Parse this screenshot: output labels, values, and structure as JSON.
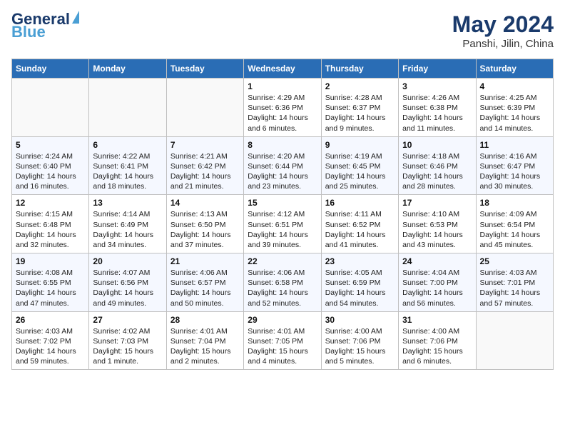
{
  "header": {
    "logo_line1": "General",
    "logo_line2": "Blue",
    "month": "May 2024",
    "location": "Panshi, Jilin, China"
  },
  "weekdays": [
    "Sunday",
    "Monday",
    "Tuesday",
    "Wednesday",
    "Thursday",
    "Friday",
    "Saturday"
  ],
  "weeks": [
    [
      {
        "day": "",
        "detail": ""
      },
      {
        "day": "",
        "detail": ""
      },
      {
        "day": "",
        "detail": ""
      },
      {
        "day": "1",
        "detail": "Sunrise: 4:29 AM\nSunset: 6:36 PM\nDaylight: 14 hours\nand 6 minutes."
      },
      {
        "day": "2",
        "detail": "Sunrise: 4:28 AM\nSunset: 6:37 PM\nDaylight: 14 hours\nand 9 minutes."
      },
      {
        "day": "3",
        "detail": "Sunrise: 4:26 AM\nSunset: 6:38 PM\nDaylight: 14 hours\nand 11 minutes."
      },
      {
        "day": "4",
        "detail": "Sunrise: 4:25 AM\nSunset: 6:39 PM\nDaylight: 14 hours\nand 14 minutes."
      }
    ],
    [
      {
        "day": "5",
        "detail": "Sunrise: 4:24 AM\nSunset: 6:40 PM\nDaylight: 14 hours\nand 16 minutes."
      },
      {
        "day": "6",
        "detail": "Sunrise: 4:22 AM\nSunset: 6:41 PM\nDaylight: 14 hours\nand 18 minutes."
      },
      {
        "day": "7",
        "detail": "Sunrise: 4:21 AM\nSunset: 6:42 PM\nDaylight: 14 hours\nand 21 minutes."
      },
      {
        "day": "8",
        "detail": "Sunrise: 4:20 AM\nSunset: 6:44 PM\nDaylight: 14 hours\nand 23 minutes."
      },
      {
        "day": "9",
        "detail": "Sunrise: 4:19 AM\nSunset: 6:45 PM\nDaylight: 14 hours\nand 25 minutes."
      },
      {
        "day": "10",
        "detail": "Sunrise: 4:18 AM\nSunset: 6:46 PM\nDaylight: 14 hours\nand 28 minutes."
      },
      {
        "day": "11",
        "detail": "Sunrise: 4:16 AM\nSunset: 6:47 PM\nDaylight: 14 hours\nand 30 minutes."
      }
    ],
    [
      {
        "day": "12",
        "detail": "Sunrise: 4:15 AM\nSunset: 6:48 PM\nDaylight: 14 hours\nand 32 minutes."
      },
      {
        "day": "13",
        "detail": "Sunrise: 4:14 AM\nSunset: 6:49 PM\nDaylight: 14 hours\nand 34 minutes."
      },
      {
        "day": "14",
        "detail": "Sunrise: 4:13 AM\nSunset: 6:50 PM\nDaylight: 14 hours\nand 37 minutes."
      },
      {
        "day": "15",
        "detail": "Sunrise: 4:12 AM\nSunset: 6:51 PM\nDaylight: 14 hours\nand 39 minutes."
      },
      {
        "day": "16",
        "detail": "Sunrise: 4:11 AM\nSunset: 6:52 PM\nDaylight: 14 hours\nand 41 minutes."
      },
      {
        "day": "17",
        "detail": "Sunrise: 4:10 AM\nSunset: 6:53 PM\nDaylight: 14 hours\nand 43 minutes."
      },
      {
        "day": "18",
        "detail": "Sunrise: 4:09 AM\nSunset: 6:54 PM\nDaylight: 14 hours\nand 45 minutes."
      }
    ],
    [
      {
        "day": "19",
        "detail": "Sunrise: 4:08 AM\nSunset: 6:55 PM\nDaylight: 14 hours\nand 47 minutes."
      },
      {
        "day": "20",
        "detail": "Sunrise: 4:07 AM\nSunset: 6:56 PM\nDaylight: 14 hours\nand 49 minutes."
      },
      {
        "day": "21",
        "detail": "Sunrise: 4:06 AM\nSunset: 6:57 PM\nDaylight: 14 hours\nand 50 minutes."
      },
      {
        "day": "22",
        "detail": "Sunrise: 4:06 AM\nSunset: 6:58 PM\nDaylight: 14 hours\nand 52 minutes."
      },
      {
        "day": "23",
        "detail": "Sunrise: 4:05 AM\nSunset: 6:59 PM\nDaylight: 14 hours\nand 54 minutes."
      },
      {
        "day": "24",
        "detail": "Sunrise: 4:04 AM\nSunset: 7:00 PM\nDaylight: 14 hours\nand 56 minutes."
      },
      {
        "day": "25",
        "detail": "Sunrise: 4:03 AM\nSunset: 7:01 PM\nDaylight: 14 hours\nand 57 minutes."
      }
    ],
    [
      {
        "day": "26",
        "detail": "Sunrise: 4:03 AM\nSunset: 7:02 PM\nDaylight: 14 hours\nand 59 minutes."
      },
      {
        "day": "27",
        "detail": "Sunrise: 4:02 AM\nSunset: 7:03 PM\nDaylight: 15 hours\nand 1 minute."
      },
      {
        "day": "28",
        "detail": "Sunrise: 4:01 AM\nSunset: 7:04 PM\nDaylight: 15 hours\nand 2 minutes."
      },
      {
        "day": "29",
        "detail": "Sunrise: 4:01 AM\nSunset: 7:05 PM\nDaylight: 15 hours\nand 4 minutes."
      },
      {
        "day": "30",
        "detail": "Sunrise: 4:00 AM\nSunset: 7:06 PM\nDaylight: 15 hours\nand 5 minutes."
      },
      {
        "day": "31",
        "detail": "Sunrise: 4:00 AM\nSunset: 7:06 PM\nDaylight: 15 hours\nand 6 minutes."
      },
      {
        "day": "",
        "detail": ""
      }
    ]
  ]
}
